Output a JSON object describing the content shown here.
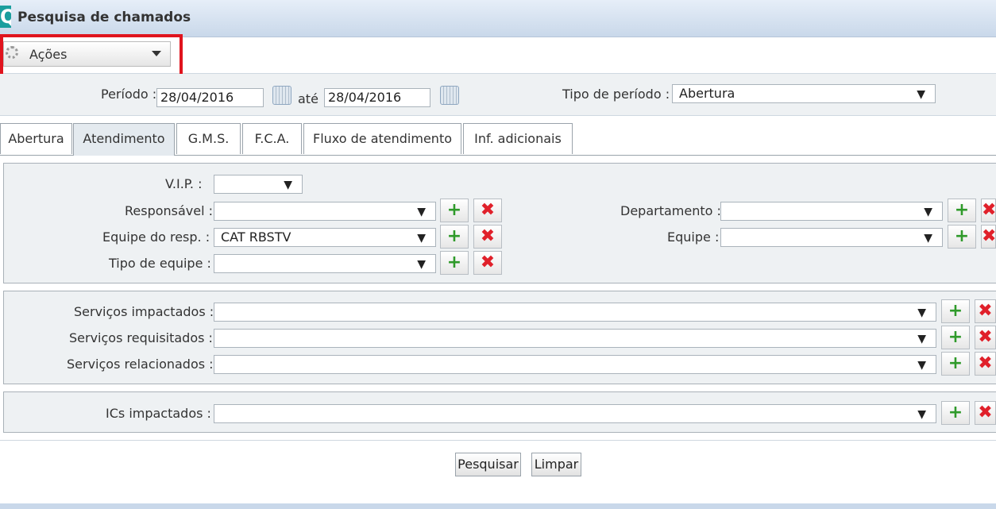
{
  "window": {
    "title": "Pesquisa de chamados",
    "app_icon": "Q"
  },
  "actions": {
    "label": "Ações"
  },
  "period": {
    "label": "Período :",
    "from": "28/04/2016",
    "to_label": "até",
    "to": "28/04/2016",
    "type_label": "Tipo de período :",
    "type_value": "Abertura"
  },
  "tabs": [
    {
      "label": "Abertura"
    },
    {
      "label": "Atendimento"
    },
    {
      "label": "G.M.S."
    },
    {
      "label": "F.C.A."
    },
    {
      "label": "Fluxo de atendimento"
    },
    {
      "label": "Inf. adicionais"
    }
  ],
  "fields": {
    "vip": {
      "label": "V.I.P. :",
      "value": ""
    },
    "responsavel": {
      "label": "Responsável :",
      "value": ""
    },
    "equipe_resp": {
      "label": "Equipe do resp. :",
      "value": "CAT RBSTV"
    },
    "tipo_equipe": {
      "label": "Tipo de equipe :",
      "value": ""
    },
    "departamento": {
      "label": "Departamento :",
      "value": ""
    },
    "equipe": {
      "label": "Equipe :",
      "value": ""
    },
    "servicos_impactados": {
      "label": "Serviços impactados :",
      "value": ""
    },
    "servicos_requisitados": {
      "label": "Serviços requisitados :",
      "value": ""
    },
    "servicos_relacionados": {
      "label": "Serviços relacionados :",
      "value": ""
    },
    "ics_impactados": {
      "label": "ICs impactados :",
      "value": ""
    }
  },
  "buttons": {
    "search": "Pesquisar",
    "clear": "Limpar"
  },
  "icons": {
    "add": "add-search-icon",
    "remove": "delete-x-icon",
    "calendar": "calendar-icon",
    "gear": "gear-icon"
  },
  "colors": {
    "highlight": "#e0141e",
    "titlebar": "#c9d8ea",
    "panel": "#eef1f3"
  }
}
